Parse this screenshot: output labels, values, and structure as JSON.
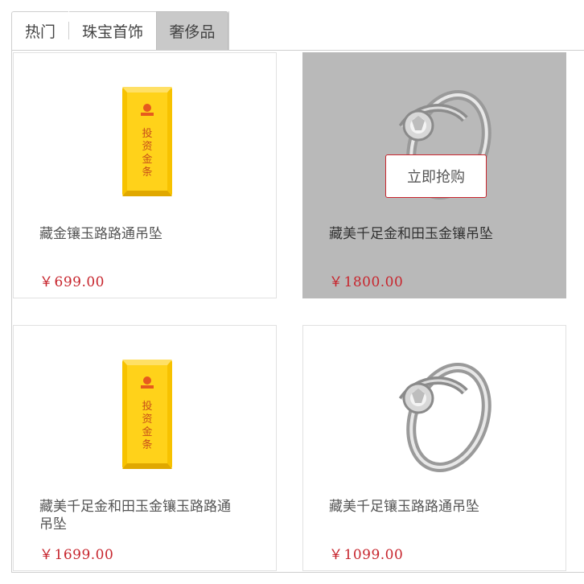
{
  "tabs": [
    {
      "label": "热门",
      "active": false
    },
    {
      "label": "珠宝首饰",
      "active": false
    },
    {
      "label": "奢侈品",
      "active": true
    }
  ],
  "products": [
    {
      "name": "藏金镶玉路路通吊坠",
      "currency": "￥",
      "price": "699.00",
      "image": "gold-bar-icon"
    },
    {
      "name": "藏美千足金和田玉金镶吊坠",
      "currency": "￥",
      "price": "1800.00",
      "image": "diamond-ring-icon",
      "hovered": true,
      "buy_label": "立即抢购"
    },
    {
      "name": "藏美千足金和田玉金镶玉路路通吊坠",
      "currency": "￥",
      "price": "1699.00",
      "image": "gold-bar-icon"
    },
    {
      "name": "藏美千足镶玉路路通吊坠",
      "currency": "￥",
      "price": "1099.00",
      "image": "diamond-ring-icon"
    }
  ],
  "gold_bar_text": "投资金条",
  "colors": {
    "price": "#c7252d",
    "hover_overlay": "#b9b9b9",
    "gold": "#f5c000"
  }
}
